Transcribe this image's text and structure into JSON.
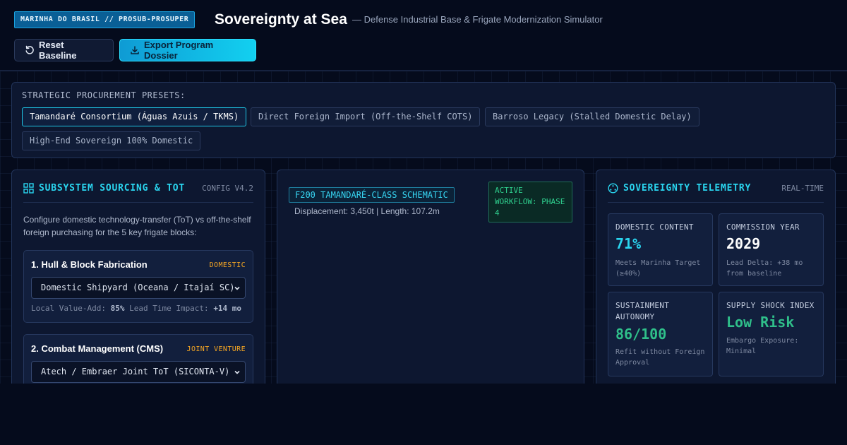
{
  "header": {
    "badge": "MARINHA DO BRASIL // PROSUB-PROSUPER",
    "title": "Sovereignty at Sea",
    "subtitle": "— Defense Industrial Base & Frigate Modernization Simulator",
    "reset_label": "Reset Baseline",
    "export_label": "Export Program Dossier"
  },
  "presets": {
    "title": "STRATEGIC PROCUREMENT PRESETS:",
    "items": [
      {
        "label": "Tamandaré Consortium (Águas Azuis / TKMS)",
        "active": true
      },
      {
        "label": "Direct Foreign Import (Off-the-Shelf COTS)",
        "active": false
      },
      {
        "label": "Barroso Legacy (Stalled Domestic Delay)",
        "active": false
      },
      {
        "label": "High-End Sovereign 100% Domestic",
        "active": false
      }
    ]
  },
  "sourcing": {
    "title": "SUBSYSTEM SOURCING & TOT",
    "tag": "CONFIG V4.2",
    "intro": "Configure domestic technology-transfer (ToT) vs off-the-shelf foreign purchasing for the 5 key frigate blocks:",
    "blocks": [
      {
        "title": "1. Hull & Block Fabrication",
        "status": "DOMESTIC",
        "selected": "Domestic Shipyard (Oceana / Itajaí SC)",
        "value_label": "Local Value-Add:",
        "value": "85%",
        "lead_label": "Lead Time Impact:",
        "lead": "+14 mo"
      },
      {
        "title": "2. Combat Management (CMS)",
        "status": "JOINT VENTURE",
        "selected": "Atech / Embraer Joint ToT (SICONTA-V)"
      }
    ]
  },
  "schematic": {
    "tag": "F200 TAMANDARÉ-CLASS SCHEMATIC",
    "specs": "Displacement: 3,450t | Length: 107.2m",
    "workflow": "ACTIVE WORKFLOW: PHASE 4"
  },
  "telemetry": {
    "title": "SOVEREIGNTY TELEMETRY",
    "tag": "REAL-TIME",
    "cards": [
      {
        "label": "DOMESTIC CONTENT",
        "value": "71%",
        "note": "Meets Marinha Target (≥40%)",
        "color": "#2ad6f0"
      },
      {
        "label": "COMMISSION YEAR",
        "value": "2029",
        "note": "Lead Delta: +38 mo from baseline",
        "color": "#ffffff"
      },
      {
        "label": "SUSTAINMENT AUTONOMY",
        "value": "86/100",
        "note": "Refit without Foreign Approval",
        "color": "#2fbf8a"
      },
      {
        "label": "SUPPLY SHOCK INDEX",
        "value": "Low Risk",
        "note": "Embargo Exposure: Minimal",
        "color": "#2fbf8a"
      }
    ]
  }
}
